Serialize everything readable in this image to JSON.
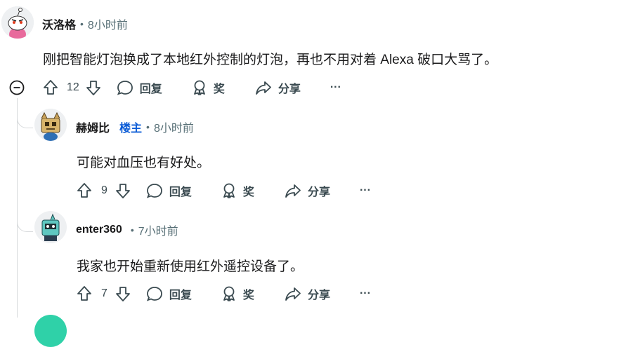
{
  "comments": [
    {
      "author": "沃洛格",
      "time": "8小时前",
      "body": "刚把智能灯泡换成了本地红外控制的灯泡，再也不用对着 Alexa 破口大骂了。",
      "score": "12",
      "reply_label": "回复",
      "award_label": "奖",
      "share_label": "分享",
      "more_label": "···"
    },
    {
      "author": "赫姆比",
      "badge": "楼主",
      "time": "8小时前",
      "body": "可能对血压也有好处。",
      "score": "9",
      "reply_label": "回复",
      "award_label": "奖",
      "share_label": "分享",
      "more_label": "···"
    },
    {
      "author": "enter360",
      "time": "7小时前",
      "body": "我家也开始重新使用红外遥控设备了。",
      "score": "7",
      "reply_label": "回复",
      "award_label": "奖",
      "share_label": "分享",
      "more_label": "···"
    }
  ],
  "separator": "•",
  "colors": {
    "op_badge": "#0a5bd6",
    "meta": "#576f76",
    "thread_line": "#d7dadc"
  }
}
